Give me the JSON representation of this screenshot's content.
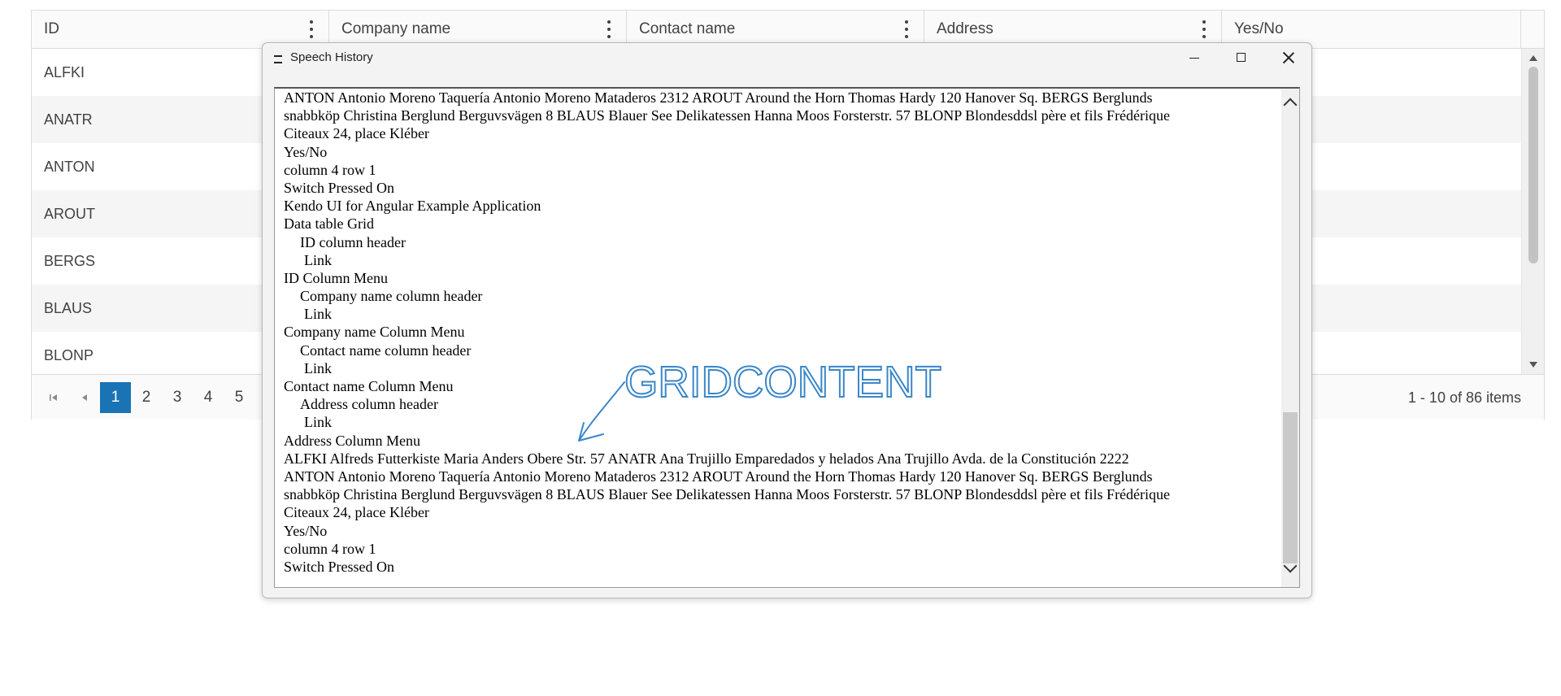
{
  "grid": {
    "columns": [
      {
        "label": "ID"
      },
      {
        "label": "Company name"
      },
      {
        "label": "Contact name"
      },
      {
        "label": "Address"
      },
      {
        "label": "Yes/No"
      }
    ],
    "rows": [
      "ALFKI",
      "ANATR",
      "ANTON",
      "AROUT",
      "BERGS",
      "BLAUS",
      "BLONP"
    ],
    "pager": {
      "pages": [
        "1",
        "2",
        "3",
        "4",
        "5"
      ],
      "active_page": "1",
      "info": "1 - 10 of 86 items"
    }
  },
  "speech_window": {
    "title": "Speech History",
    "lines": [
      {
        "text": "ANTON Antonio Moreno Taquería Antonio Moreno Mataderos 2312 AROUT Around the Horn Thomas Hardy 120 Hanover Sq. BERGS Berglunds",
        "indent": 0
      },
      {
        "text": "snabbköp Christina Berglund Berguvsvägen 8 BLAUS Blauer See Delikatessen Hanna Moos Forsterstr. 57 BLONP Blondesddsl père et fils Frédérique",
        "indent": 0
      },
      {
        "text": "Citeaux 24, place Kléber",
        "indent": 0
      },
      {
        "text": "Yes/No",
        "indent": 0
      },
      {
        "text": "column 4 row 1",
        "indent": 0
      },
      {
        "text": "Switch Pressed On",
        "indent": 0
      },
      {
        "text": "Kendo UI for Angular Example Application",
        "indent": 0
      },
      {
        "text": "Data table Grid",
        "indent": 0
      },
      {
        "text": "ID column header",
        "indent": 1
      },
      {
        "text": "Link",
        "indent": 2
      },
      {
        "text": "ID Column Menu",
        "indent": 0
      },
      {
        "text": "Company name column header",
        "indent": 1
      },
      {
        "text": "Link",
        "indent": 2
      },
      {
        "text": "Company name Column Menu",
        "indent": 0
      },
      {
        "text": "Contact name column header",
        "indent": 1
      },
      {
        "text": "Link",
        "indent": 2
      },
      {
        "text": "Contact name Column Menu",
        "indent": 0
      },
      {
        "text": "Address column header",
        "indent": 1
      },
      {
        "text": "Link",
        "indent": 2
      },
      {
        "text": "Address Column Menu",
        "indent": 0
      },
      {
        "text": "ALFKI Alfreds Futterkiste Maria Anders Obere Str. 57 ANATR Ana Trujillo Emparedados y helados Ana Trujillo Avda. de la Constitución 2222",
        "indent": 0
      },
      {
        "text": "ANTON Antonio Moreno Taquería Antonio Moreno Mataderos 2312 AROUT Around the Horn Thomas Hardy 120 Hanover Sq. BERGS Berglunds",
        "indent": 0
      },
      {
        "text": "snabbköp Christina Berglund Berguvsvägen 8 BLAUS Blauer See Delikatessen Hanna Moos Forsterstr. 57 BLONP Blondesddsl père et fils Frédérique",
        "indent": 0
      },
      {
        "text": "Citeaux 24, place Kléber",
        "indent": 0
      },
      {
        "text": "Yes/No",
        "indent": 0
      },
      {
        "text": "column 4 row 1",
        "indent": 0
      },
      {
        "text": "Switch Pressed On",
        "indent": 0
      }
    ]
  },
  "annotation": {
    "text": "GRIDCONTENT",
    "color": "#3a86c8"
  },
  "colors": {
    "accent": "#1a73b5",
    "header_bg": "#fafafa",
    "alt_row_bg": "#f5f5f5"
  },
  "icons": {
    "column_menu": "vertical-ellipsis-icon",
    "first_page": "first-page-icon",
    "prev_page": "previous-page-icon",
    "window_menu": "hamburger-icon",
    "minimize": "minimize-icon",
    "maximize": "maximize-icon",
    "close": "close-icon"
  }
}
